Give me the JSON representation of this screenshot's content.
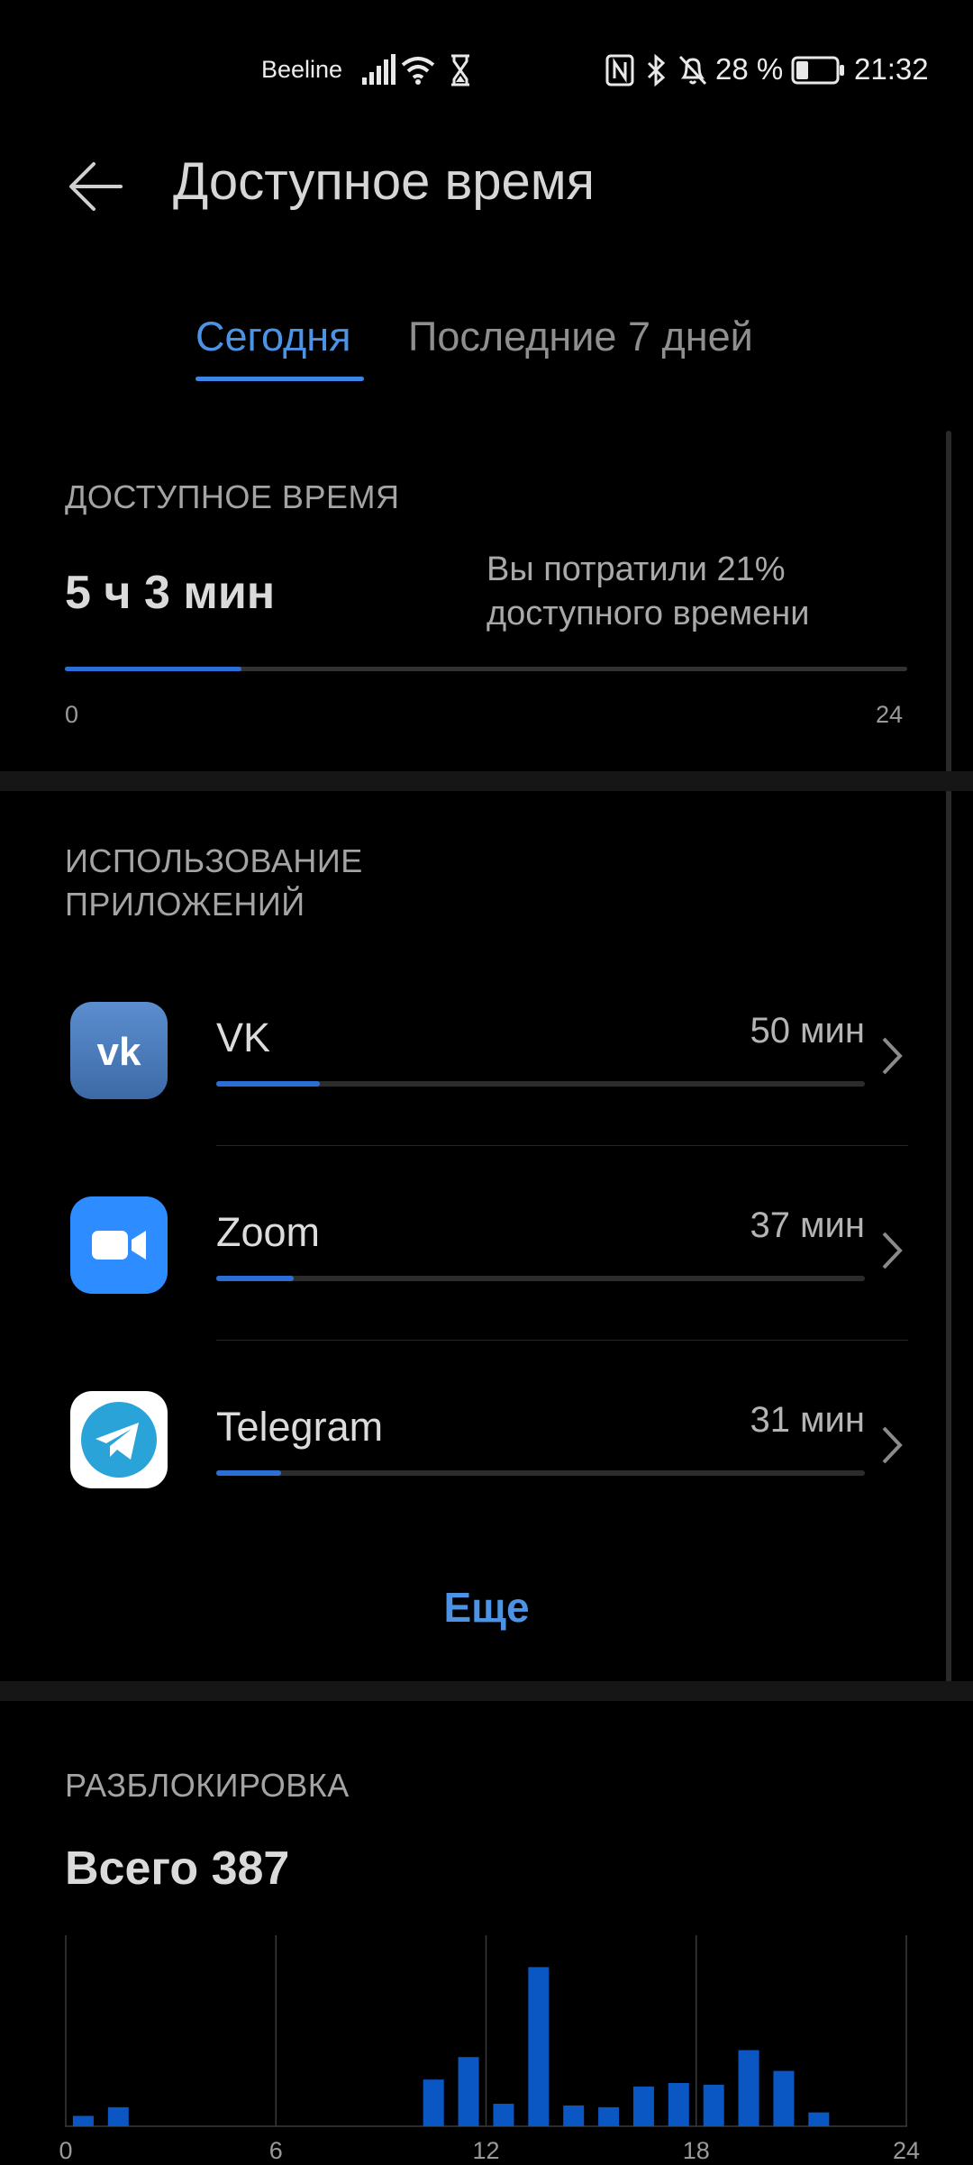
{
  "status_bar": {
    "carrier": "Beeline",
    "battery_percent": "28 %",
    "time": "21:32",
    "icons": [
      "signal-icon",
      "wifi-icon",
      "hourglass-icon",
      "nfc-icon",
      "bluetooth-icon",
      "bell-off-icon",
      "battery-icon"
    ]
  },
  "header": {
    "title": "Доступное время",
    "back_icon": "arrow-left-icon"
  },
  "tabs": [
    {
      "label": "Сегодня",
      "active": true
    },
    {
      "label": "Последние 7 дней",
      "active": false
    }
  ],
  "available_time": {
    "section_label": "ДОСТУПНОЕ ВРЕМЯ",
    "value": "5 ч 3 мин",
    "note": "Вы потратили 21% доступного времени",
    "progress_fraction": 0.21,
    "axis_min": "0",
    "axis_max": "24"
  },
  "app_usage": {
    "section_label_line1": "ИСПОЛЬЗОВАНИЕ",
    "section_label_line2": "ПРИЛОЖЕНИЙ",
    "apps": [
      {
        "name": "VK",
        "time": "50 мин",
        "fraction": 0.16,
        "icon": "vk-icon",
        "color": "#4a76a8"
      },
      {
        "name": "Zoom",
        "time": "37 мин",
        "fraction": 0.12,
        "icon": "zoom-icon",
        "color": "#2d8cff"
      },
      {
        "name": "Telegram",
        "time": "31 мин",
        "fraction": 0.1,
        "icon": "telegram-icon",
        "color": "#2aa3d9"
      }
    ],
    "more_label": "Еще"
  },
  "unlocks": {
    "section_label": "РАЗБЛОКИРОВКА",
    "total": "Всего 387"
  },
  "chart_data": {
    "type": "bar",
    "title": "",
    "xlabel": "",
    "ylabel": "",
    "x_ticks": [
      "0",
      "6",
      "12",
      "18",
      "24"
    ],
    "xlim": [
      0,
      24
    ],
    "x": [
      0.5,
      1.5,
      10.5,
      11.5,
      12.5,
      13.5,
      14.5,
      15.5,
      16.5,
      17.5,
      18.5,
      19.5,
      20.5,
      21.5
    ],
    "values": [
      6,
      11,
      27,
      40,
      13,
      92,
      12,
      11,
      23,
      25,
      24,
      44,
      32,
      8
    ],
    "grid": true,
    "color": "#0a56c2"
  },
  "colors": {
    "accent": "#4c93e5",
    "bar": "#0a56c2",
    "background": "#000000"
  }
}
